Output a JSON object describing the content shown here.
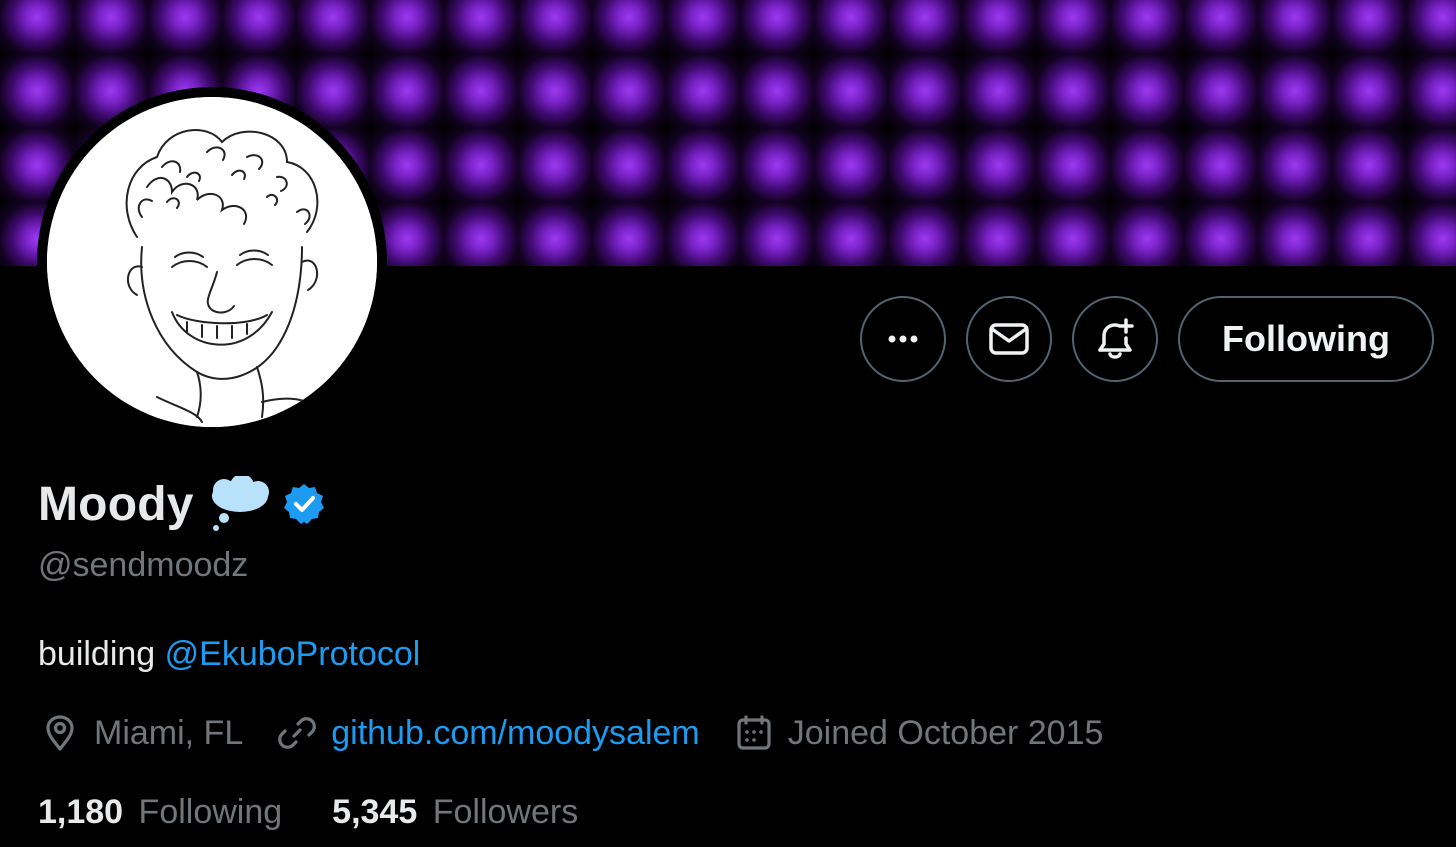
{
  "profile": {
    "display_name": "Moody",
    "name_emoji": "thought-balloon",
    "verified": true,
    "handle": "@sendmoodz",
    "bio_text": "building ",
    "bio_mention": "@EkuboProtocol",
    "location": "Miami, FL",
    "website": "github.com/moodysalem",
    "joined": "Joined October 2015"
  },
  "stats": {
    "following_count": "1,180",
    "following_label": "Following",
    "followers_count": "5,345",
    "followers_label": "Followers"
  },
  "actions": {
    "more_icon": "more-icon",
    "message_icon": "envelope-icon",
    "notify_icon": "bell-plus-icon",
    "follow_label": "Following"
  },
  "colors": {
    "accent": "#1d9bf0",
    "secondary_text": "#71767b",
    "primary_text": "#e7e9ea",
    "banner_purple": "#9b3bf0"
  }
}
